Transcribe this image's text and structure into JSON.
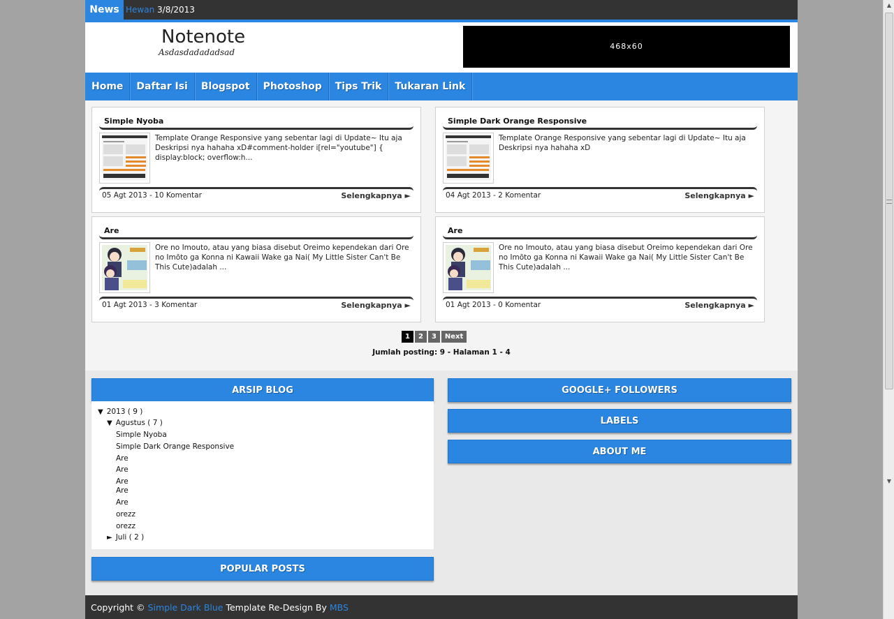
{
  "ticker": {
    "label": "News",
    "category": "Hewan",
    "date": "3/8/2013"
  },
  "header": {
    "title": "Notenote",
    "description": "Asdasdadadadsad",
    "ad_text": "468x60"
  },
  "nav": {
    "items": [
      "Home",
      "Daftar Isi",
      "Blogspot",
      "Photoshop",
      "Tips Trik",
      "Tukaran Link"
    ]
  },
  "posts": [
    {
      "title": "Simple Nyoba",
      "excerpt": "Template Orange Responsive yang sebentar lagi di Update~ Itu aja Deskripsi nya hahaha xD#comment-holder i[rel=\"youtube\"] { display:block; overflow:h...",
      "meta": "05 Agt 2013 - 10 Komentar",
      "more": "Selengkapnya ►",
      "thumb": "template-screenshot"
    },
    {
      "title": "Simple Dark Orange Responsive",
      "excerpt": "Template Orange Responsive yang sebentar lagi di Update~ Itu aja Deskripsi nya hahaha xD",
      "meta": "04 Agt 2013 - 2 Komentar",
      "more": "Selengkapnya ►",
      "thumb": "template-screenshot"
    },
    {
      "title": "Are",
      "excerpt": "Ore no Imouto, atau yang biasa disebut Oreimo kependekan dari Ore no Imōto ga Konna ni Kawaii Wake ga Nai( My Little Sister Can't Be This Cute)adalah ...",
      "meta": "01 Agt 2013 - 3 Komentar",
      "more": "Selengkapnya ►",
      "thumb": "anime-image"
    },
    {
      "title": "Are",
      "excerpt": "Ore no Imouto, atau yang biasa disebut Oreimo kependekan dari Ore no Imōto ga Konna ni Kawaii Wake ga Nai( My Little Sister Can't Be This Cute)adalah ...",
      "meta": "01 Agt 2013 - 0 Komentar",
      "more": "Selengkapnya ►",
      "thumb": "anime-image"
    }
  ],
  "pagination": {
    "pages": [
      "1",
      "2",
      "3"
    ],
    "current": "1",
    "next": "Next",
    "summary": "Jumlah posting: 9 - Halaman 1 - 4"
  },
  "widgets": {
    "archive_title": "ARSIP BLOG",
    "archive": {
      "year": "2013",
      "year_count": "( 9 )",
      "month": "Agustus",
      "month_count": "( 7 )",
      "posts": [
        "Simple Nyoba",
        "Simple Dark Orange Responsive",
        "Are",
        "Are",
        "Are",
        "Are",
        "Are",
        "orezz",
        "orezz"
      ],
      "collapsed_month": "Juli",
      "collapsed_count": "( 2 )"
    },
    "popular_title": "POPULAR POSTS",
    "followers_title": "GOOGLE+ FOLLOWERS",
    "labels_title": "LABELS",
    "about_title": "ABOUT ME"
  },
  "footer": {
    "prefix": "Copyright © ",
    "template_link": "Simple Dark Blue",
    "middle": " Template Re-Design By ",
    "author_link": "MBS"
  },
  "colors": {
    "accent": "#2a86e0",
    "dark": "#333333",
    "page_bg": "#a3a3a3"
  }
}
